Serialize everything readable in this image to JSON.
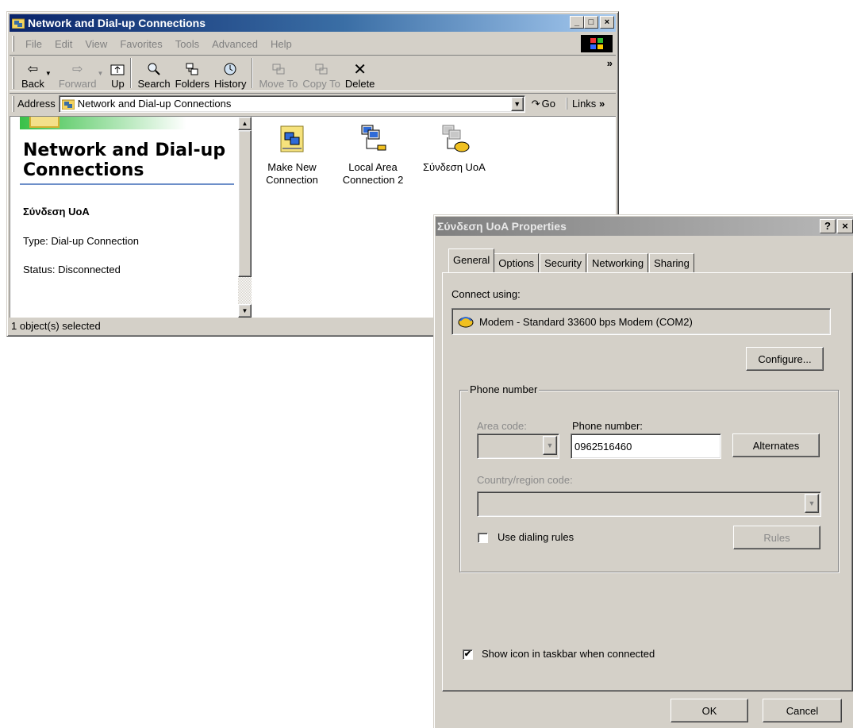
{
  "explorer": {
    "title": "Network and Dial-up Connections",
    "window_buttons": {
      "minimize": "_",
      "maximize": "□",
      "close": "×"
    },
    "menu": [
      "File",
      "Edit",
      "View",
      "Favorites",
      "Tools",
      "Advanced",
      "Help"
    ],
    "toolbar": {
      "back": "Back",
      "forward": "Forward",
      "up": "Up",
      "search": "Search",
      "folders": "Folders",
      "history": "History",
      "move_to": "Move To",
      "copy_to": "Copy To",
      "delete": "Delete",
      "more": "»"
    },
    "address": {
      "label": "Address",
      "value": "Network and Dial-up Connections",
      "go": "Go",
      "links": "Links",
      "links_more": "»"
    },
    "left_pane": {
      "title": "Network and Dial-up Connections",
      "selected_name": "Σύνδεση UoA",
      "type": "Type: Dial-up Connection",
      "status": "Status: Disconnected"
    },
    "icons": [
      "Make New Connection",
      "Local Area Connection 2",
      "Σύνδεση UoA"
    ],
    "status_bar": "1 object(s) selected"
  },
  "dialog": {
    "title": "Σύνδεση UoA Properties",
    "help_btn": "?",
    "close_btn": "×",
    "tabs": [
      "General",
      "Options",
      "Security",
      "Networking",
      "Sharing"
    ],
    "connect_using_label": "Connect using:",
    "device": "Modem - Standard 33600 bps Modem (COM2)",
    "configure": "Configure...",
    "phone_group_title": "Phone number",
    "area_code_label": "Area code:",
    "phone_number_label": "Phone number:",
    "phone_number_value": "0962516460",
    "alternates": "Alternates",
    "country_label": "Country/region code:",
    "use_dialing_rules": "Use dialing rules",
    "use_dialing_rules_checked": false,
    "rules": "Rules",
    "show_icon": "Show icon in taskbar when connected",
    "show_icon_checked": true,
    "ok": "OK",
    "cancel": "Cancel"
  }
}
